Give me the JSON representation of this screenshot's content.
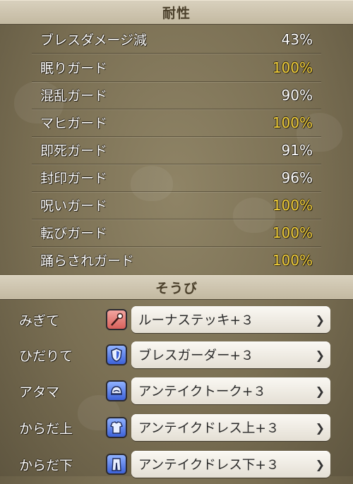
{
  "resist_header": "耐性",
  "resistances": [
    {
      "label": "ブレスダメージ減",
      "value": "43%",
      "max": false
    },
    {
      "label": "眠りガード",
      "value": "100%",
      "max": true
    },
    {
      "label": "混乱ガード",
      "value": "90%",
      "max": false
    },
    {
      "label": "マヒガード",
      "value": "100%",
      "max": true
    },
    {
      "label": "即死ガード",
      "value": "91%",
      "max": false
    },
    {
      "label": "封印ガード",
      "value": "96%",
      "max": false
    },
    {
      "label": "呪いガード",
      "value": "100%",
      "max": true
    },
    {
      "label": "転びガード",
      "value": "100%",
      "max": true
    },
    {
      "label": "踊らされガード",
      "value": "100%",
      "max": true
    }
  ],
  "equip_header": "そうび",
  "equipment": [
    {
      "slot": "みぎて",
      "item": "ルーナステッキ+３",
      "icon": "staff-icon"
    },
    {
      "slot": "ひだりて",
      "item": "ブレスガーダー+３",
      "icon": "shield-icon"
    },
    {
      "slot": "アタマ",
      "item": "アンテイクトーク+３",
      "icon": "helmet-icon"
    },
    {
      "slot": "からだ上",
      "item": "アンテイクドレス上+３",
      "icon": "torso-armor-icon"
    },
    {
      "slot": "からだ下",
      "item": "アンテイクドレス下+３",
      "icon": "leg-armor-icon"
    }
  ],
  "colors": {
    "max_value": "#f3d03a",
    "normal_value": "#ffffff"
  }
}
